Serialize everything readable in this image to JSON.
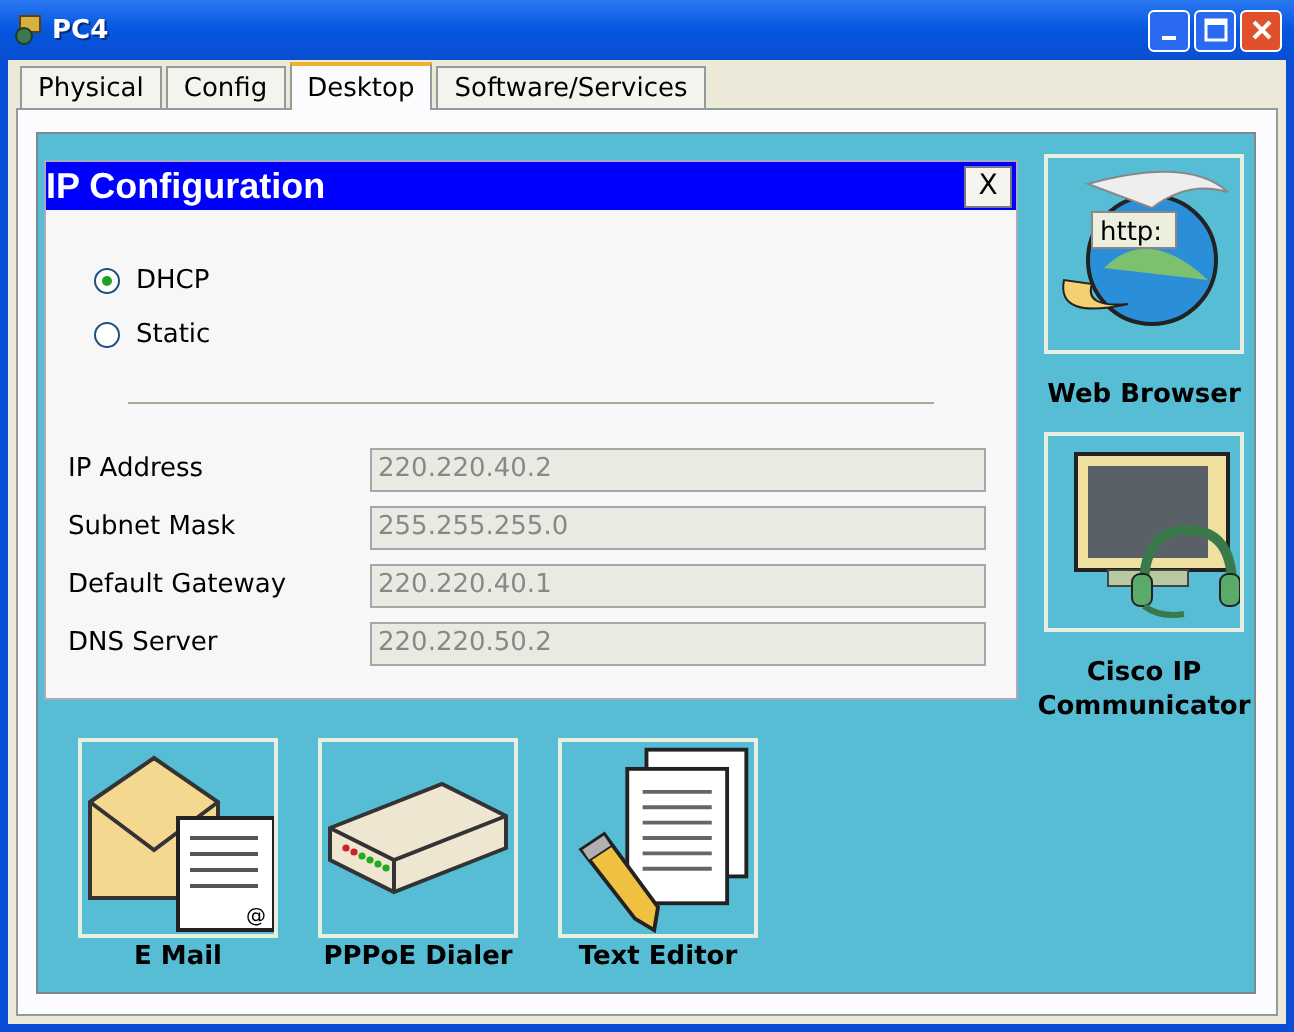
{
  "window": {
    "title": "PC4"
  },
  "tabs": [
    {
      "label": "Physical",
      "selected": false
    },
    {
      "label": "Config",
      "selected": false
    },
    {
      "label": "Desktop",
      "selected": true
    },
    {
      "label": "Software/Services",
      "selected": false
    }
  ],
  "dialog": {
    "title": "IP Configuration",
    "close": "X",
    "modes": [
      {
        "label": "DHCP",
        "selected": true
      },
      {
        "label": "Static",
        "selected": false
      }
    ],
    "fields": [
      {
        "label": "IP Address",
        "value": "220.220.40.2",
        "disabled": true
      },
      {
        "label": "Subnet Mask",
        "value": "255.255.255.0",
        "disabled": true
      },
      {
        "label": "Default Gateway",
        "value": "220.220.40.1",
        "disabled": true
      },
      {
        "label": "DNS Server",
        "value": "220.220.50.2",
        "disabled": true
      }
    ]
  },
  "apps_bottom": [
    {
      "kind": "mail",
      "label": "E Mail",
      "icon_text": "@"
    },
    {
      "kind": "dialer",
      "label": "PPPoE Dialer"
    },
    {
      "kind": "editor",
      "label": "Text Editor"
    }
  ],
  "apps_right": [
    {
      "kind": "browser",
      "label": "Web Browser",
      "icon_text": "http:"
    },
    {
      "kind": "phone",
      "label": "Cisco IP Communicator"
    }
  ]
}
